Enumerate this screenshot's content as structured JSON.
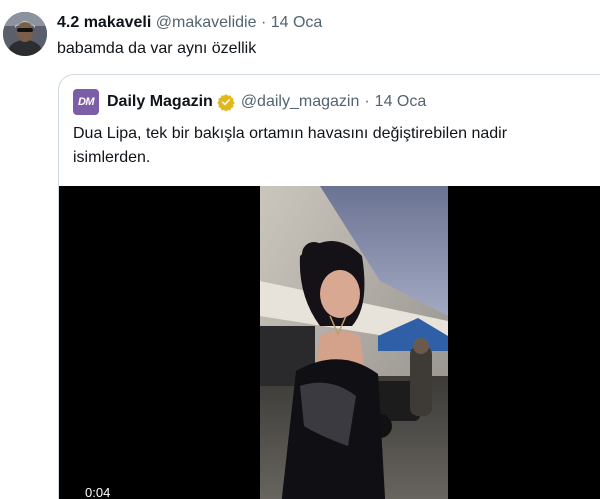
{
  "tweet": {
    "display_name": "4.2 makaveli",
    "handle": "@makavelidie",
    "separator": "·",
    "date": "14 Oca",
    "text": "babamda da var aynı özellik"
  },
  "quote": {
    "avatar_text": "DM",
    "display_name": "Daily Magazin",
    "handle": "@daily_magazin",
    "separator": "·",
    "date": "14 Oca",
    "text": "Dua Lipa, tek bir bakışla ortamın havasını değiştirebilen nadir isimlerden.",
    "video": {
      "timestamp": "0:04"
    }
  },
  "colors": {
    "text_primary": "#0f1419",
    "text_secondary": "#536471",
    "border": "#cfd9de",
    "quote_avatar": "#7b5ea7",
    "verified_badge": "#e2b719"
  }
}
